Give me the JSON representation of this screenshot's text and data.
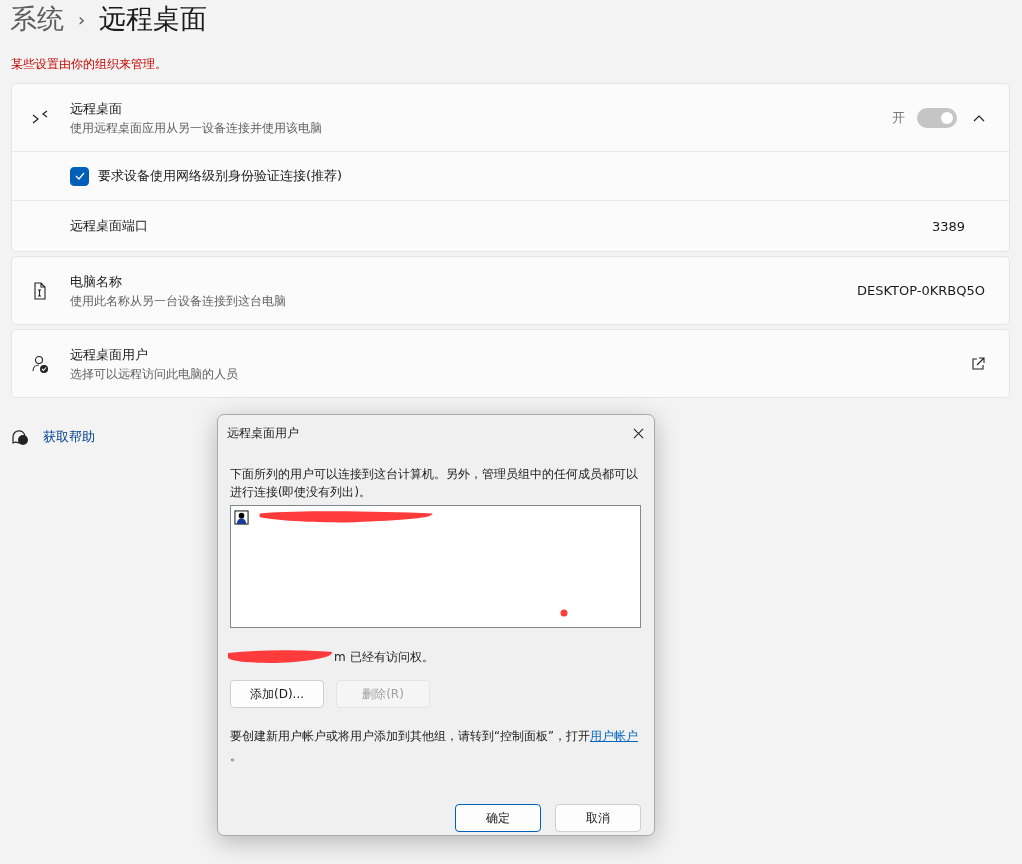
{
  "breadcrumb": {
    "parent": "系统",
    "separator": "›",
    "current": "远程桌面"
  },
  "managed_notice": "某些设置由你的组织来管理。",
  "remote_desktop": {
    "title": "远程桌面",
    "description": "使用远程桌面应用从另一设备连接并使用该电脑",
    "toggle_label": "开",
    "on": true,
    "disabled": true,
    "expanded": true,
    "nla": {
      "label": "要求设备使用网络级别身份验证连接(推荐)",
      "checked": true
    },
    "port": {
      "label": "远程桌面端口",
      "value": "3389"
    }
  },
  "pc_name": {
    "title": "电脑名称",
    "description": "使用此名称从另一台设备连接到这台电脑",
    "value": "DESKTOP-0KRBQ5O"
  },
  "users_card": {
    "title": "远程桌面用户",
    "description": "选择可以远程访问此电脑的人员"
  },
  "help_link": "获取帮助",
  "dialog": {
    "title": "远程桌面用户",
    "intro": "下面所列的用户可以连接到这台计算机。另外，管理员组中的任何成员都可以进行连接(即使没有列出)。",
    "access_text": "m 已经有访问权。",
    "buttons": [
      {
        "label": "添加(D)...",
        "disabled": false
      },
      {
        "label": "删除(R)",
        "disabled": true
      }
    ],
    "footer_text": "要创建新用户帐户或将用户添加到其他组，请转到“控制面板”，打开",
    "footer_link": "用户帐户",
    "footer_end": "。",
    "ok": "确定",
    "cancel": "取消"
  }
}
